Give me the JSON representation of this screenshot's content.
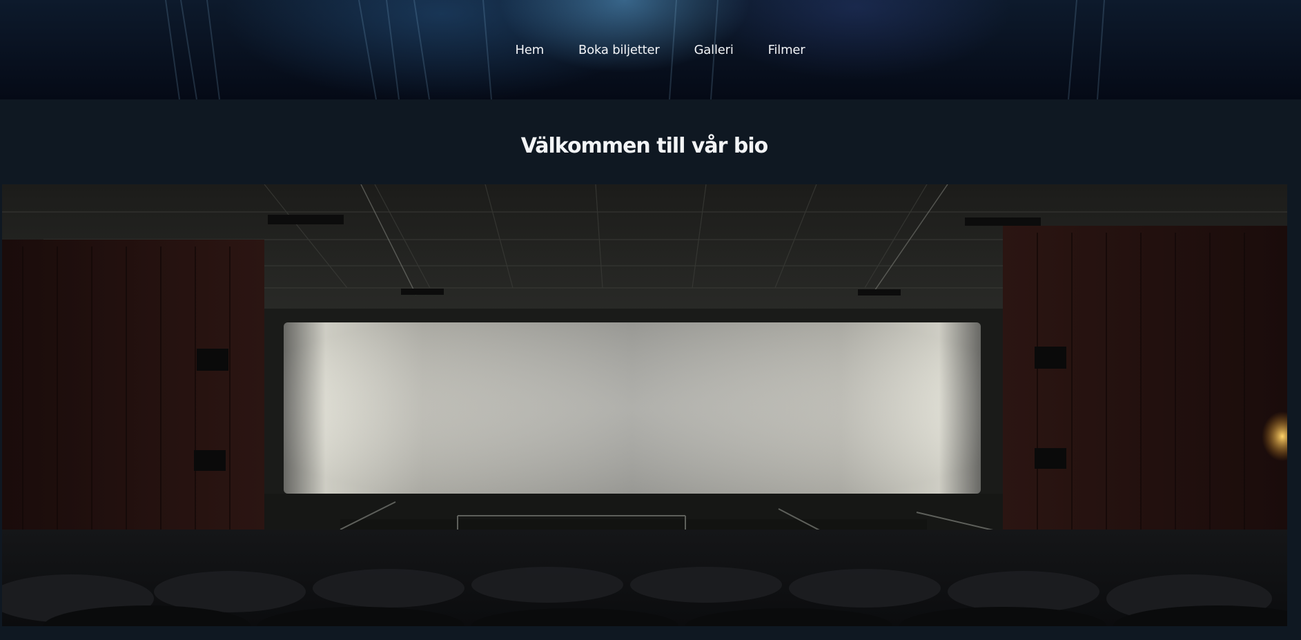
{
  "nav": {
    "items": [
      {
        "label": "Hem"
      },
      {
        "label": "Boka biljetter"
      },
      {
        "label": "Galleri"
      },
      {
        "label": "Filmer"
      }
    ]
  },
  "main": {
    "title": "Välkommen till vår bio"
  },
  "colors": {
    "page_background": "#0f1822",
    "header_dark": "#050a16",
    "header_glow": "#5aa0d2",
    "text": "#f3f5f7"
  }
}
